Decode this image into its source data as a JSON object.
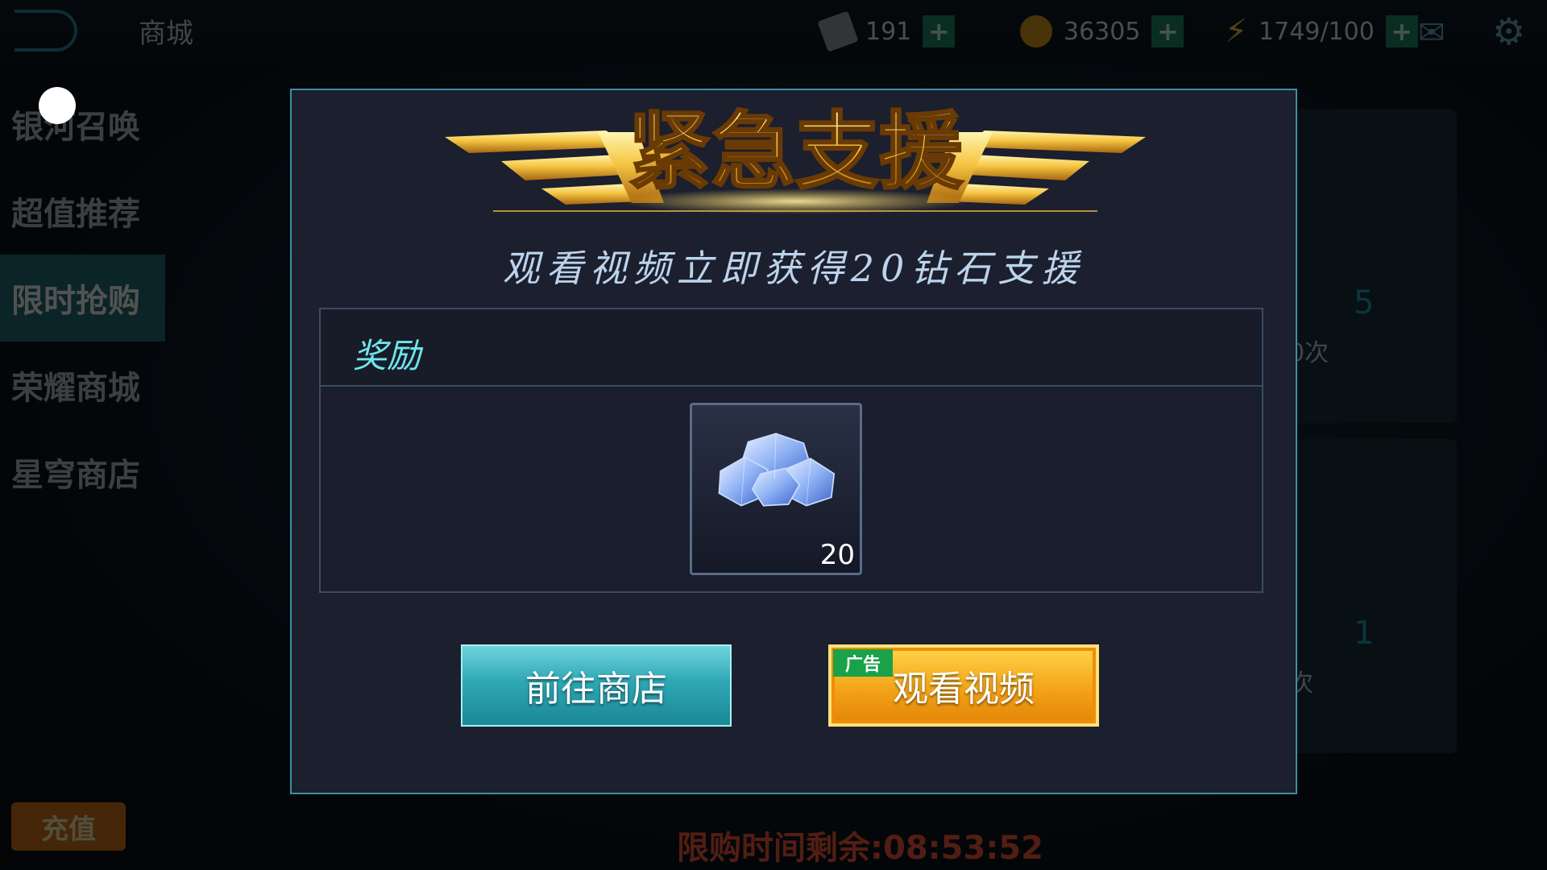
{
  "background": {
    "shop_title": "商城",
    "resources": {
      "tickets": "191",
      "coins": "36305",
      "energy": "1749/100"
    },
    "sidebar_items": [
      "银河召唤",
      "超值推荐",
      "限时抢购",
      "荣耀商城",
      "星穹商店"
    ],
    "active_sidebar_index": 2,
    "recharge_label": "充值",
    "timer_text": "限购时间剩余:08:53:52",
    "card_numbers": [
      "5",
      "1"
    ],
    "card_texts": [
      "0次",
      "次"
    ]
  },
  "modal": {
    "title": "紧急支援",
    "subtitle": "观看视频立即获得20钻石支援",
    "reward_label": "奖励",
    "reward_item": {
      "icon": "diamond-icon",
      "count": "20"
    },
    "buttons": {
      "shop_label": "前往商店",
      "video_label": "观看视频",
      "ad_tag": "广告"
    }
  },
  "colors": {
    "gold": "#f5c542",
    "teal": "#2ea8b6",
    "orange": "#f3a417",
    "panel_border": "#3c8fa6"
  }
}
